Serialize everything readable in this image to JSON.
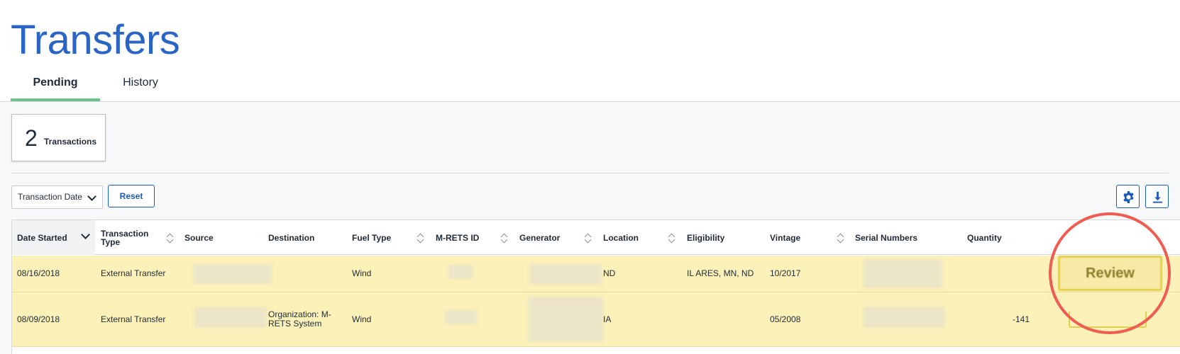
{
  "page": {
    "title": "Transfers"
  },
  "tabs": [
    {
      "label": "Pending",
      "active": true
    },
    {
      "label": "History",
      "active": false
    }
  ],
  "summary": {
    "count": "2",
    "label": "Transactions"
  },
  "toolbar": {
    "sort_select_value": "Transaction Date",
    "reset_label": "Reset",
    "settings_icon": "gear-icon",
    "download_icon": "download-icon"
  },
  "table": {
    "columns": [
      "Date Started",
      "Transaction Type",
      "Source",
      "Destination",
      "Fuel Type",
      "M-RETS ID",
      "Generator",
      "Location",
      "Eligibility",
      "Vintage",
      "Serial Numbers",
      "Quantity"
    ],
    "rows": [
      {
        "date_started": "08/16/2018",
        "transaction_type": "External Transfer",
        "destination": "",
        "fuel_type": "Wind",
        "location": "ND",
        "eligibility": "IL ARES, MN, ND",
        "vintage": "10/2017",
        "quantity": ""
      },
      {
        "date_started": "08/09/2018",
        "transaction_type": "External Transfer",
        "destination": "Organization: M-RETS System",
        "fuel_type": "Wind",
        "location": "IA",
        "eligibility": "",
        "vintage": "05/2008",
        "quantity": "-141"
      }
    ]
  },
  "review_button": {
    "label": "Review"
  },
  "colors": {
    "brand_blue": "#2a64c5",
    "tab_accent": "#6bc48b",
    "pending_row": "#fcf1b8",
    "highlight": "#ee5c52"
  }
}
